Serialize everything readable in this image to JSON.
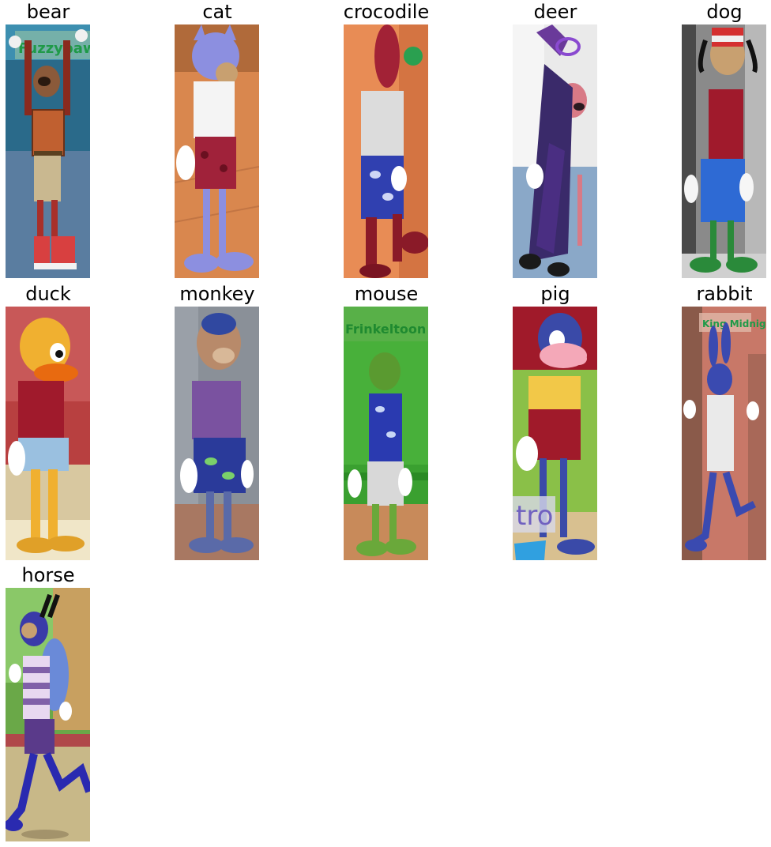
{
  "grid": {
    "items": [
      {
        "label": "bear",
        "image_name": "bear-toon-image",
        "sign_text": "Fuzzypaws"
      },
      {
        "label": "cat",
        "image_name": "cat-toon-image",
        "sign_text": ""
      },
      {
        "label": "crocodile",
        "image_name": "crocodile-toon-image",
        "sign_text": ""
      },
      {
        "label": "deer",
        "image_name": "deer-toon-image",
        "sign_text": ""
      },
      {
        "label": "dog",
        "image_name": "dog-toon-image",
        "sign_text": ""
      },
      {
        "label": "duck",
        "image_name": "duck-toon-image",
        "sign_text": ""
      },
      {
        "label": "monkey",
        "image_name": "monkey-toon-image",
        "sign_text": ""
      },
      {
        "label": "mouse",
        "image_name": "mouse-toon-image",
        "sign_text": "King Lucky Frinkeltoon"
      },
      {
        "label": "pig",
        "image_name": "pig-toon-image",
        "sign_text": "tro"
      },
      {
        "label": "rabbit",
        "image_name": "rabbit-toon-image",
        "sign_text": "King Midnight"
      },
      {
        "label": "horse",
        "image_name": "horse-toon-image",
        "sign_text": ""
      }
    ]
  }
}
